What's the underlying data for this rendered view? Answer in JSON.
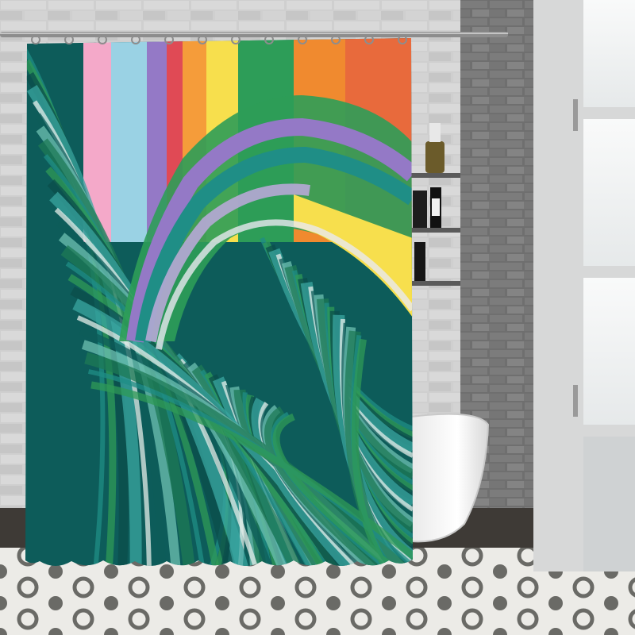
{
  "scene": {
    "subject": "shower-curtain",
    "palette": {
      "wall_brick": "#cfcfcf",
      "mortar": "#a9a9a9",
      "dark_wall": "#6f6f6f",
      "window_light": "#f2f4f5",
      "floor_tile": "#ecebe7",
      "floor_pattern": "#6a6a66",
      "tub": "#f6f6f6",
      "rod": "#8d8d8d",
      "teal_dark": "#0d5c5a",
      "teal": "#1f8e86",
      "green": "#2f9a57",
      "lilac": "#b7a9d6",
      "rainbow": [
        "#f4a9c9",
        "#9ad2e4",
        "#9479c6",
        "#e04a55",
        "#f59c3a",
        "#f7df4d",
        "#2d9d58",
        "#f08a2f",
        "#e86a3c"
      ]
    },
    "objects": [
      "curtain-rod",
      "shower-curtain",
      "brick-wall",
      "wall-shelf",
      "bottles",
      "bathtub",
      "window",
      "patterned-floor"
    ]
  }
}
